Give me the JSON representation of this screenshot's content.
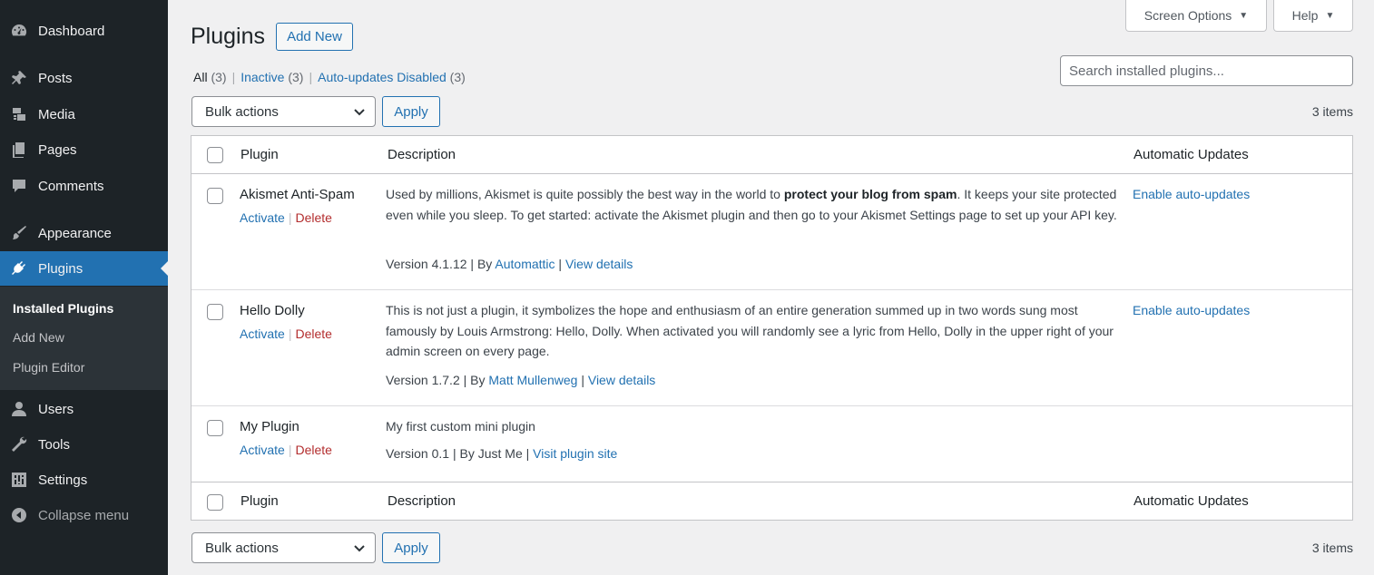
{
  "sidebar": {
    "items": [
      {
        "label": "Dashboard",
        "icon": "dashboard-icon"
      },
      {
        "label": "Posts",
        "icon": "pushpin-icon"
      },
      {
        "label": "Media",
        "icon": "media-icon"
      },
      {
        "label": "Pages",
        "icon": "pages-icon"
      },
      {
        "label": "Comments",
        "icon": "comment-icon"
      },
      {
        "label": "Appearance",
        "icon": "brush-icon"
      },
      {
        "label": "Plugins",
        "icon": "plugin-icon"
      },
      {
        "label": "Users",
        "icon": "user-icon"
      },
      {
        "label": "Tools",
        "icon": "wrench-icon"
      },
      {
        "label": "Settings",
        "icon": "settings-icon"
      },
      {
        "label": "Collapse menu",
        "icon": "collapse-icon"
      }
    ],
    "submenu": [
      "Installed Plugins",
      "Add New",
      "Plugin Editor"
    ],
    "active": "Plugins"
  },
  "top_tabs": {
    "screen_options": "Screen Options",
    "help": "Help"
  },
  "header": {
    "title": "Plugins",
    "add_new": "Add New"
  },
  "filters": [
    {
      "label": "All",
      "count": "(3)"
    },
    {
      "label": "Inactive",
      "count": "(3)"
    },
    {
      "label": "Auto-updates Disabled",
      "count": "(3)"
    }
  ],
  "search": {
    "placeholder": "Search installed plugins..."
  },
  "bulk": {
    "selected": "Bulk actions",
    "apply": "Apply",
    "count": "3 items"
  },
  "table": {
    "columns": {
      "plugin": "Plugin",
      "description": "Description",
      "auto": "Automatic Updates"
    },
    "plugins": [
      {
        "name": "Akismet Anti-Spam",
        "activate": "Activate",
        "delete": "Delete",
        "desc_pre": "Used by millions, Akismet is quite possibly the best way in the world to ",
        "desc_bold": "protect your blog from spam",
        "desc_post": ". It keeps your site protected even while you sleep. To get started: activate the Akismet plugin and then go to your Akismet Settings page to set up your API key.",
        "version": "Version 4.1.12",
        "by": "By",
        "author": "Automattic",
        "details": "View details",
        "auto": "Enable auto-updates"
      },
      {
        "name": "Hello Dolly",
        "activate": "Activate",
        "delete": "Delete",
        "desc_pre": "This is not just a plugin, it symbolizes the hope and enthusiasm of an entire generation summed up in two words sung most famously by Louis Armstrong: Hello, Dolly. When activated you will randomly see a lyric from Hello, Dolly in the upper right of your admin screen on every page.",
        "desc_bold": "",
        "desc_post": "",
        "version": "Version 1.7.2",
        "by": "By",
        "author": "Matt Mullenweg",
        "details": "View details",
        "auto": "Enable auto-updates"
      },
      {
        "name": "My Plugin",
        "activate": "Activate",
        "delete": "Delete",
        "desc_pre": "My first custom mini plugin",
        "desc_bold": "",
        "desc_post": "",
        "version": "Version 0.1",
        "by": "By Just Me",
        "author": "",
        "details": "Visit plugin site",
        "auto": ""
      }
    ]
  },
  "colors": {
    "sidebar": "#1d2327",
    "accent": "#2271b1",
    "delete": "#b32d2e"
  }
}
